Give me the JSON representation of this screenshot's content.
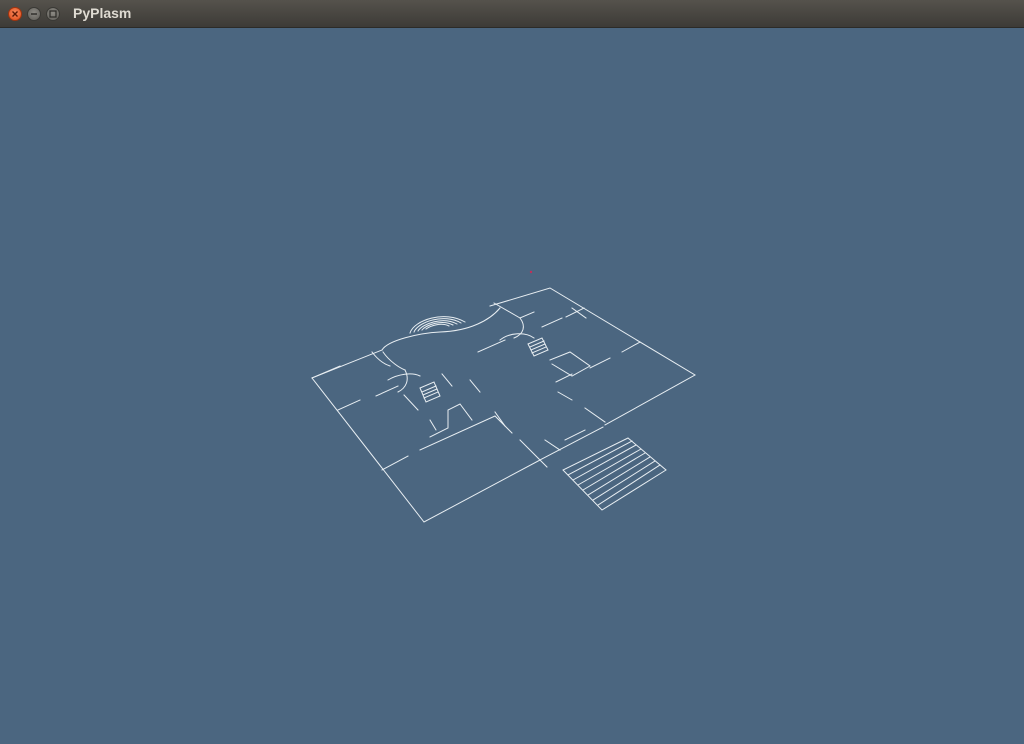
{
  "window": {
    "title": "PyPlasm",
    "buttons": {
      "close_icon": "close-icon",
      "minimize_icon": "minimize-icon",
      "maximize_icon": "maximize-icon"
    }
  },
  "viewport": {
    "background_color": "#4b6680",
    "line_color": "#e8eef2",
    "content": "floor-plan-wireframe"
  }
}
